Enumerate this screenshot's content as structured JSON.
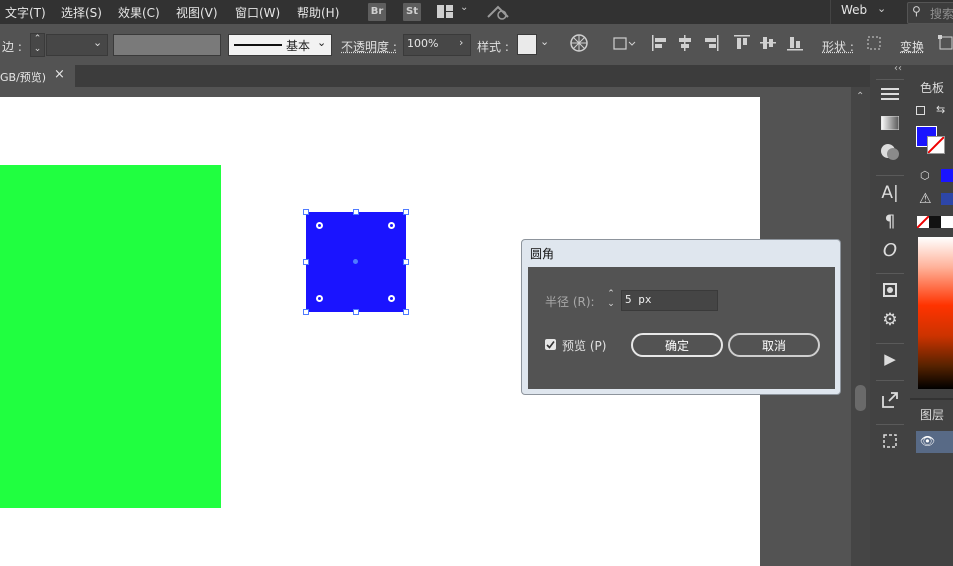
{
  "menu": {
    "items": [
      "文字(T)",
      "选择(S)",
      "效果(C)",
      "视图(V)",
      "窗口(W)",
      "帮助(H)"
    ]
  },
  "app_icons": {
    "bridge": "Br",
    "stock": "St"
  },
  "workspace": {
    "label": "Web"
  },
  "search": {
    "placeholder": "搜索"
  },
  "control_bar": {
    "stroke_label": "边 :",
    "brush_label": "基本",
    "opacity_label": "不透明度 :",
    "opacity_value": "100%",
    "style_label": "样式 :",
    "shape_label": "形状 :",
    "transform_label": "变换"
  },
  "document_tab": {
    "title": "GB/预览)",
    "close": "×"
  },
  "right_panel": {
    "swatches_label": "色板",
    "layers_label": "图层"
  },
  "dialog": {
    "title": "圆角",
    "radius_label": "半径 (R):",
    "radius_value": "5 px",
    "preview_label": "预览 (P)",
    "preview_checked": true,
    "ok_label": "确定",
    "cancel_label": "取消"
  },
  "colors": {
    "green_shape": "#20ff40",
    "blue_shape": "#1a14ff",
    "fill_swatch": "#1a14ff"
  }
}
